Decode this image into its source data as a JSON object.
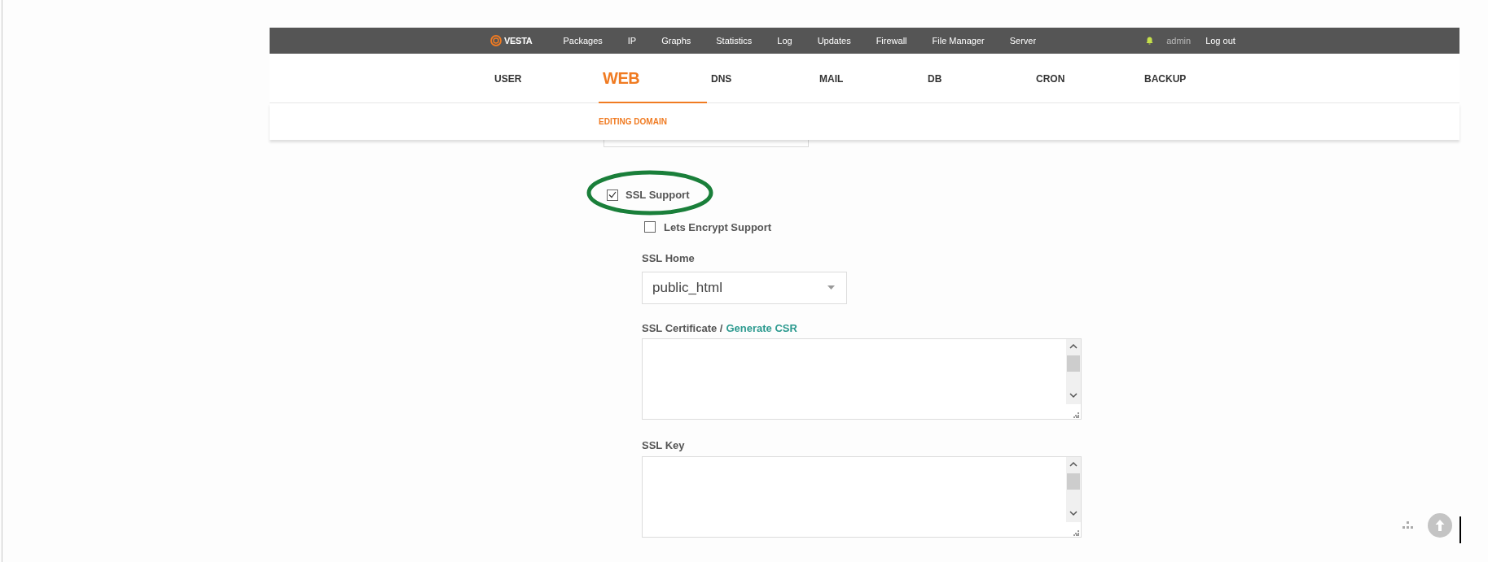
{
  "topbar": {
    "logo": "VESTA",
    "menu": [
      "Packages",
      "IP",
      "Graphs",
      "Statistics",
      "Log",
      "Updates",
      "Firewall",
      "File Manager",
      "Server"
    ],
    "user": "admin",
    "logout": "Log out"
  },
  "tabs": [
    {
      "label": "USER",
      "selected": false
    },
    {
      "label": "WEB",
      "selected": true
    },
    {
      "label": "DNS",
      "selected": false
    },
    {
      "label": "MAIL",
      "selected": false
    },
    {
      "label": "DB",
      "selected": false
    },
    {
      "label": "CRON",
      "selected": false
    },
    {
      "label": "BACKUP",
      "selected": false
    }
  ],
  "subtitle": "EDITING DOMAIN",
  "form": {
    "ssl_support": {
      "label": "SSL Support",
      "checked": true
    },
    "letsencrypt": {
      "label": "Lets Encrypt Support",
      "checked": false
    },
    "ssl_home": {
      "label": "SSL Home",
      "value": "public_html"
    },
    "ssl_certificate": {
      "label": "SSL Certificate /",
      "link": "Generate CSR"
    },
    "ssl_key": {
      "label": "SSL Key"
    }
  }
}
